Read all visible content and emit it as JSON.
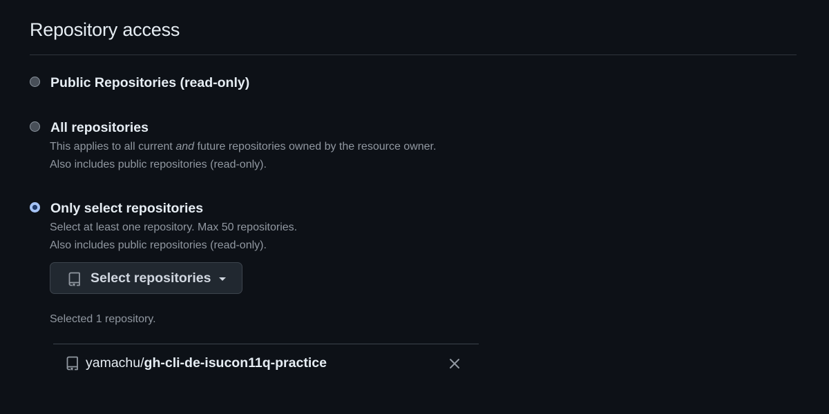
{
  "section": {
    "title": "Repository access"
  },
  "options": {
    "public": {
      "label": "Public Repositories (read-only)",
      "checked": false
    },
    "all": {
      "label": "All repositories",
      "desc_prefix": "This applies to all current ",
      "desc_emphasis": "and",
      "desc_suffix": " future repositories owned by the resource owner.",
      "desc_line2": "Also includes public repositories (read-only).",
      "checked": false
    },
    "select": {
      "label": "Only select repositories",
      "desc_line1": "Select at least one repository. Max 50 repositories.",
      "desc_line2": "Also includes public repositories (read-only).",
      "checked": true
    }
  },
  "select_button": {
    "label": "Select repositories",
    "icon": "repo-icon"
  },
  "selection": {
    "count_text": "Selected 1 repository.",
    "repos": [
      {
        "owner": "yamachu/",
        "name": "gh-cli-de-isucon11q-practice",
        "icon": "repo-icon"
      }
    ]
  },
  "colors": {
    "background": "#0d1117",
    "text_primary": "#e6edf3",
    "text_muted": "#9198a1",
    "accent_radio": "#a5c3f5",
    "border": "#30363d"
  }
}
